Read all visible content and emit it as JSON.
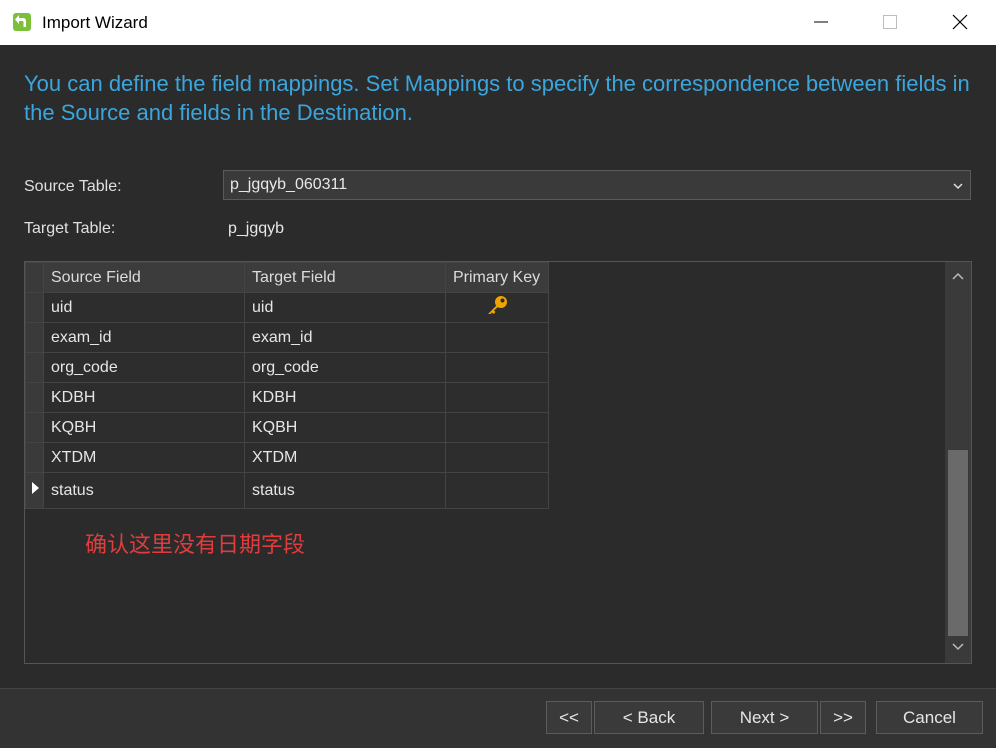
{
  "window": {
    "title": "Import Wizard"
  },
  "intro_text": "You can define the field mappings. Set Mappings to specify the correspondence between fields in the Source and fields in the Destination.",
  "source_table": {
    "label": "Source Table:",
    "value": "p_jgqyb_060311"
  },
  "target_table": {
    "label": "Target Table:",
    "value": "p_jgqyb"
  },
  "grid": {
    "headers": [
      "Source Field",
      "Target Field",
      "Primary Key"
    ],
    "rows": [
      {
        "source": "uid",
        "target": "uid",
        "primary_key": true
      },
      {
        "source": "exam_id",
        "target": "exam_id",
        "primary_key": false
      },
      {
        "source": "org_code",
        "target": "org_code",
        "primary_key": false
      },
      {
        "source": "KDBH",
        "target": "KDBH",
        "primary_key": false
      },
      {
        "source": "KQBH",
        "target": "KQBH",
        "primary_key": false
      },
      {
        "source": "XTDM",
        "target": "XTDM",
        "primary_key": false
      },
      {
        "source": "status",
        "target": "status",
        "primary_key": false,
        "current": true
      }
    ]
  },
  "annotation": "确认这里没有日期字段",
  "buttons": {
    "first": "<<",
    "back": "< Back",
    "next": "Next >",
    "last": ">>",
    "cancel": "Cancel"
  },
  "colors": {
    "accent_text": "#3aa6dd",
    "annotation": "#e03c3c",
    "key_icon": "#f0a400"
  },
  "icons": {
    "app": "import-arrow-icon",
    "key": "key-icon",
    "current_row": "row-pointer-icon"
  }
}
